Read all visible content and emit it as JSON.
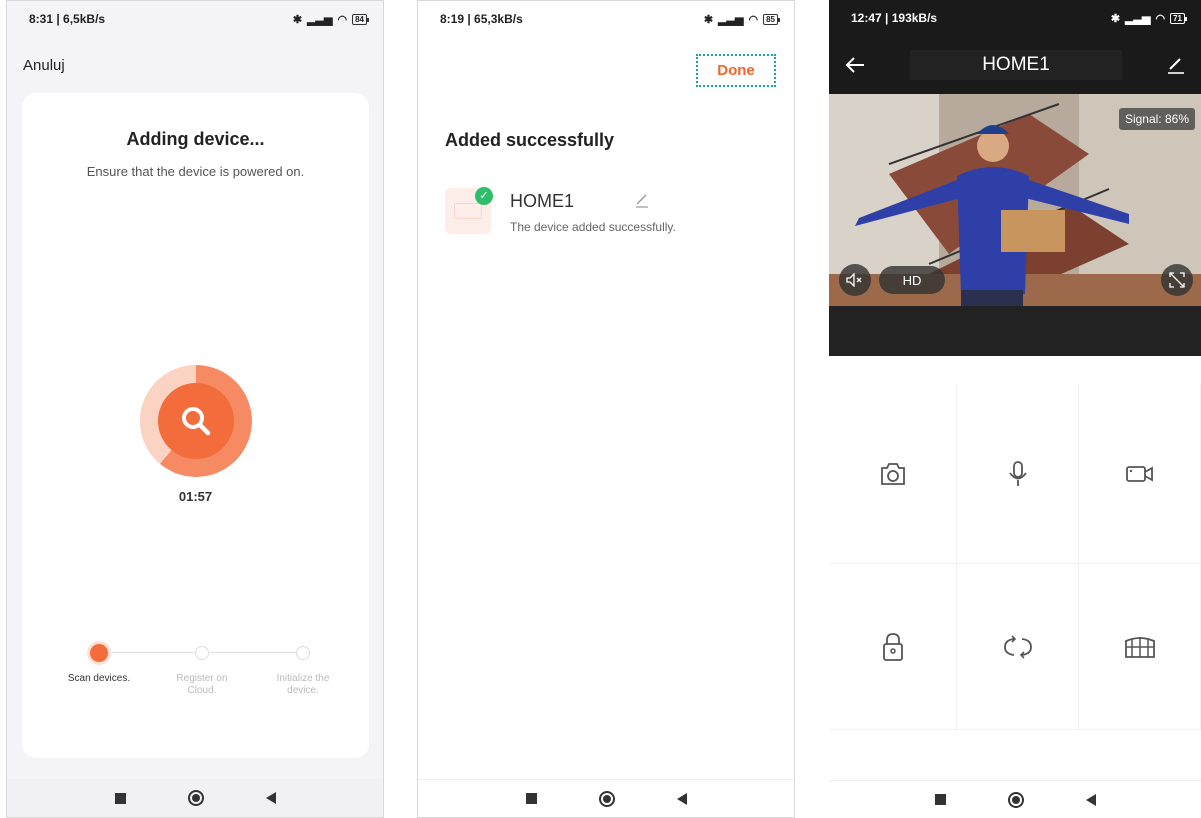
{
  "panel1": {
    "status": {
      "left": "8:31 | 6,5kB/s",
      "battery": "84"
    },
    "cancel_label": "Anuluj",
    "title": "Adding device...",
    "subtitle": "Ensure that the device is powered on.",
    "timer": "01:57",
    "steps": [
      {
        "label": "Scan devices.",
        "active": true
      },
      {
        "label": "Register on Cloud.",
        "active": false
      },
      {
        "label": "Initialize the device.",
        "active": false
      }
    ]
  },
  "panel2": {
    "status": {
      "left": "8:19 | 65,3kB/s",
      "battery": "85"
    },
    "done_label": "Done",
    "title": "Added successfully",
    "device_name": "HOME1",
    "device_status": "The device added successfully."
  },
  "panel3": {
    "status": {
      "left": "12:47 | 193kB/s",
      "battery": "71"
    },
    "title": "HOME1",
    "signal": "Signal: 86%",
    "quality": "HD",
    "controls": [
      "camera-icon",
      "microphone-icon",
      "video-record-icon",
      "lock-icon",
      "rotate-icon",
      "gate-icon"
    ]
  },
  "colors": {
    "accent": "#f26c3c",
    "success": "#2dbf6b",
    "dark_bar": "#1a1a1a"
  }
}
